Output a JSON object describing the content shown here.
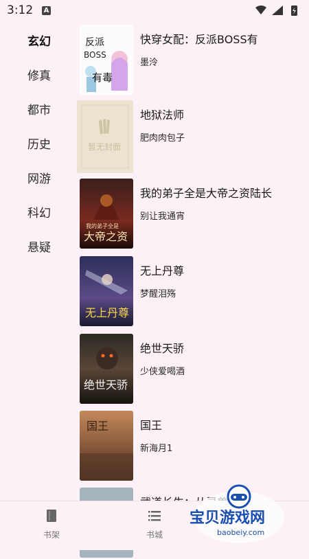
{
  "status_bar": {
    "time": "3:12",
    "indicator": "A"
  },
  "sidebar": {
    "categories": [
      {
        "label": "玄幻",
        "active": true
      },
      {
        "label": "修真",
        "active": false
      },
      {
        "label": "都市",
        "active": false
      },
      {
        "label": "历史",
        "active": false
      },
      {
        "label": "网游",
        "active": false
      },
      {
        "label": "科幻",
        "active": false
      },
      {
        "label": "悬疑",
        "active": false
      }
    ]
  },
  "books": [
    {
      "title": "快穿女配：反派BOSS有",
      "author": "墨泠",
      "cover_text": "反派BOSS有毒"
    },
    {
      "title": "地狱法师",
      "author": "肥肉肉包子",
      "cover_text": "暂无封面"
    },
    {
      "title": "我的弟子全是大帝之资陆长",
      "author": "别让我通宵",
      "cover_text": "我的弟子全是大帝之资"
    },
    {
      "title": "无上丹尊",
      "author": "梦醒泪殇",
      "cover_text": "无上丹尊"
    },
    {
      "title": "绝世天骄",
      "author": "少侠爱喝酒",
      "cover_text": "绝世天骄"
    },
    {
      "title": "国王",
      "author": "新海月1",
      "cover_text": "国王"
    },
    {
      "title": "武道长生：从灵兽开始",
      "author": "",
      "cover_text": ""
    }
  ],
  "bottom_nav": {
    "items": [
      {
        "label": "书架",
        "icon": "book-icon"
      },
      {
        "label": "书城",
        "icon": "list-icon"
      }
    ]
  },
  "watermark": {
    "text": "宝贝游戏网",
    "url": "baobeiy.com"
  },
  "colors": {
    "background": "#fcf1f6",
    "watermark_blue": "#1a4fb0"
  }
}
